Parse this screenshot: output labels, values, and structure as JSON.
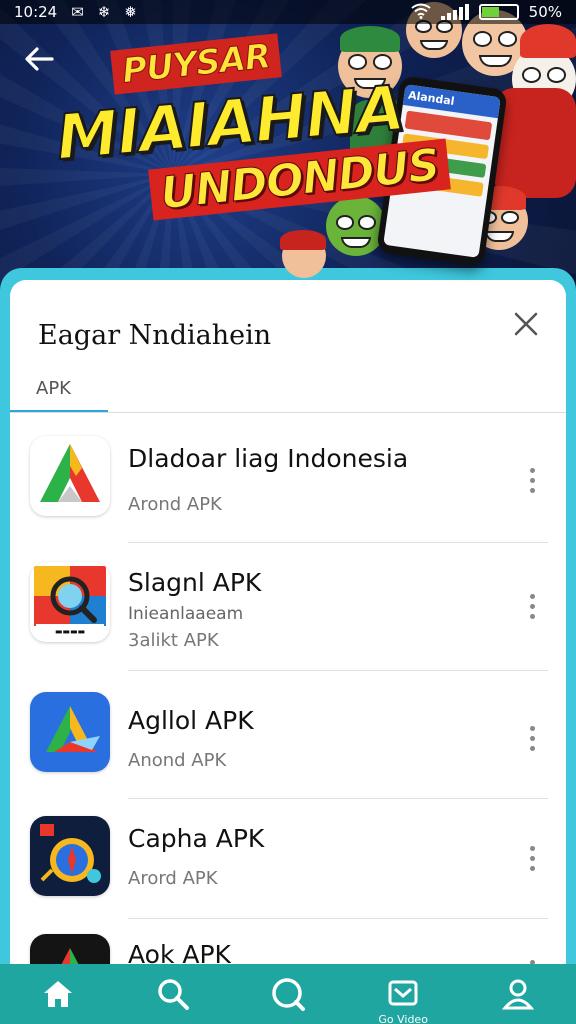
{
  "status_bar": {
    "time": "10:24",
    "battery_percent": "50%",
    "battery_level": 0.5
  },
  "banner": {
    "line1": "PUYSAR",
    "line2": "MIAIAHNA",
    "line3": "UNDONDUS",
    "phone_header": "Alandal"
  },
  "sheet": {
    "title": "Eagar Nndiahein",
    "tab_label": "APK"
  },
  "apps": [
    {
      "name": "Dladoar liag Indonesia",
      "subtitle": "Arond APK",
      "icon": "triangle-play-icon"
    },
    {
      "name": "Slagnl APK",
      "subtitle": "Inieanlaaeam",
      "subtitle2": "3alikt APK",
      "icon": "magnifier-badge-icon"
    },
    {
      "name": "Agllol APK",
      "subtitle": "Anond APK",
      "icon": "blue-triangle-icon"
    },
    {
      "name": "Capha APK",
      "subtitle": "Arord APK",
      "icon": "compass-icon"
    },
    {
      "name": "Aok APK",
      "subtitle": "",
      "icon": "dark-triangle-icon"
    }
  ],
  "bottom_nav": [
    {
      "label": "",
      "icon": "home-icon"
    },
    {
      "label": "",
      "icon": "search-icon"
    },
    {
      "label": "",
      "icon": "chat-search-icon"
    },
    {
      "label": "Go Video",
      "icon": "mail-icon"
    },
    {
      "label": "",
      "icon": "person-icon"
    }
  ],
  "colors": {
    "accent": "#3ec7dd",
    "nav": "#1fa6a0",
    "banner_red": "#d0241f",
    "banner_yellow": "#ffe43a"
  }
}
